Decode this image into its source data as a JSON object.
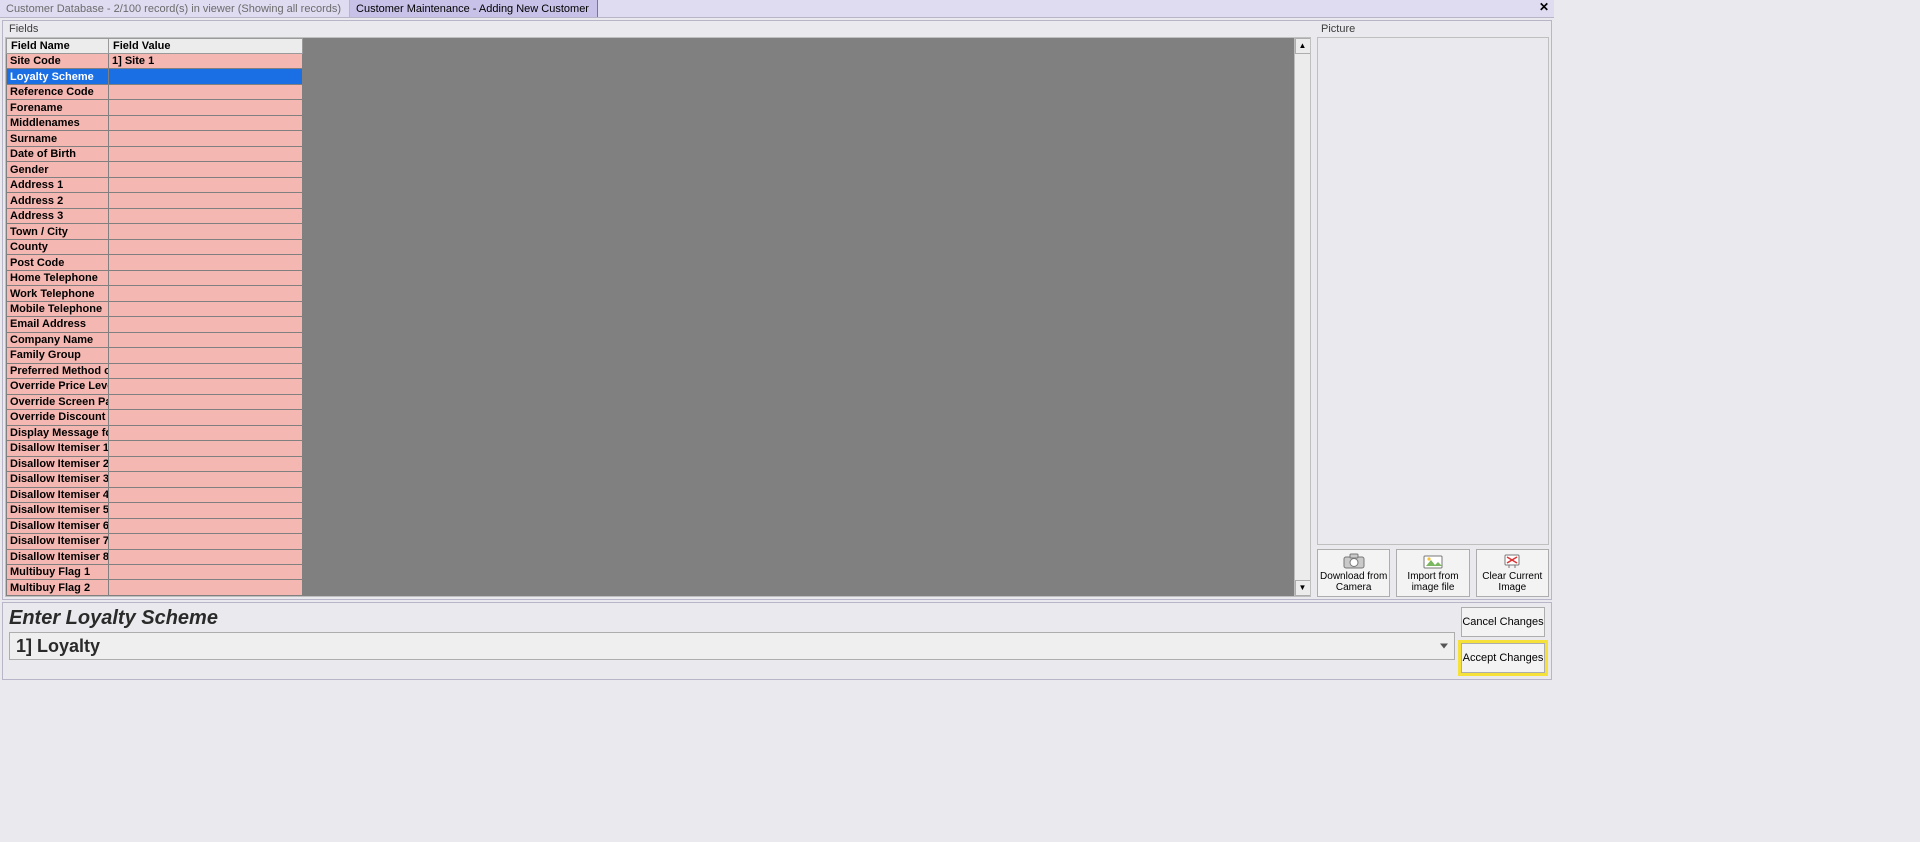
{
  "tabs": {
    "inactive": "Customer Database - 2/100 record(s) in viewer (Showing all records)",
    "active": "Customer Maintenance - Adding New Customer"
  },
  "panels": {
    "fields_title": "Fields",
    "picture_title": "Picture"
  },
  "grid": {
    "headers": {
      "name": "Field Name",
      "value": "Field Value"
    },
    "rows": [
      {
        "name": "Site Code",
        "value": "1] Site 1"
      },
      {
        "name": "Loyalty Scheme",
        "value": "",
        "selected": true
      },
      {
        "name": "Reference Code",
        "value": ""
      },
      {
        "name": "Forename",
        "value": ""
      },
      {
        "name": "Middlenames",
        "value": ""
      },
      {
        "name": "Surname",
        "value": ""
      },
      {
        "name": "Date of Birth",
        "value": ""
      },
      {
        "name": "Gender",
        "value": ""
      },
      {
        "name": "Address 1",
        "value": ""
      },
      {
        "name": "Address 2",
        "value": ""
      },
      {
        "name": "Address 3",
        "value": ""
      },
      {
        "name": "Town / City",
        "value": ""
      },
      {
        "name": "County",
        "value": ""
      },
      {
        "name": "Post Code",
        "value": ""
      },
      {
        "name": "Home Telephone",
        "value": ""
      },
      {
        "name": "Work Telephone",
        "value": ""
      },
      {
        "name": "Mobile Telephone",
        "value": ""
      },
      {
        "name": "Email Address",
        "value": ""
      },
      {
        "name": "Company Name",
        "value": ""
      },
      {
        "name": "Family Group",
        "value": ""
      },
      {
        "name": "Preferred Method of Contact",
        "value": ""
      },
      {
        "name": "Override Price Level for Group",
        "value": ""
      },
      {
        "name": "Override Screen Page for Group",
        "value": ""
      },
      {
        "name": "Override Discount Percentage",
        "value": ""
      },
      {
        "name": "Display Message for Clerk",
        "value": ""
      },
      {
        "name": "Disallow Itemiser 1",
        "value": ""
      },
      {
        "name": "Disallow Itemiser 2",
        "value": ""
      },
      {
        "name": "Disallow Itemiser 3",
        "value": ""
      },
      {
        "name": "Disallow Itemiser 4",
        "value": ""
      },
      {
        "name": "Disallow Itemiser 5",
        "value": ""
      },
      {
        "name": "Disallow Itemiser 6",
        "value": ""
      },
      {
        "name": "Disallow Itemiser 7",
        "value": ""
      },
      {
        "name": "Disallow Itemiser 8",
        "value": ""
      },
      {
        "name": "Multibuy Flag 1",
        "value": ""
      },
      {
        "name": "Multibuy Flag 2",
        "value": ""
      }
    ]
  },
  "picture_buttons": {
    "download": "Download from Camera",
    "import": "Import from image file",
    "clear": "Clear Current Image"
  },
  "entry": {
    "prompt": "Enter Loyalty Scheme",
    "value": "1]  Loyalty"
  },
  "actions": {
    "cancel": "Cancel Changes",
    "accept": "Accept Changes"
  }
}
